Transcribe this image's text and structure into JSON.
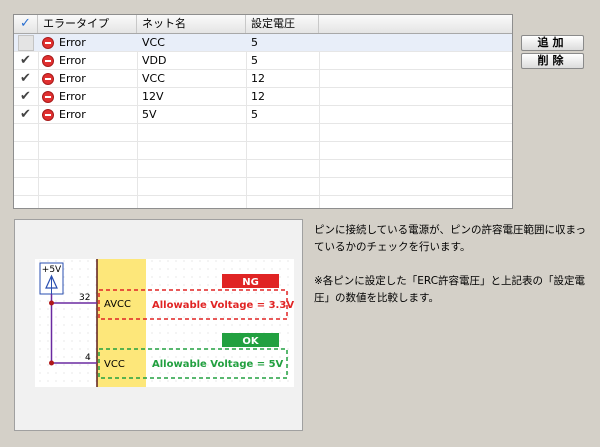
{
  "table": {
    "headers": {
      "check": "✓",
      "error_type": "エラータイプ",
      "net_name": "ネット名",
      "voltage": "設定電圧"
    },
    "rows": [
      {
        "checked": false,
        "error": "Error",
        "net": "VCC",
        "voltage": "5",
        "selected": true
      },
      {
        "checked": true,
        "error": "Error",
        "net": "VDD",
        "voltage": "5",
        "selected": false
      },
      {
        "checked": true,
        "error": "Error",
        "net": "VCC",
        "voltage": "12",
        "selected": false
      },
      {
        "checked": true,
        "error": "Error",
        "net": "12V",
        "voltage": "12",
        "selected": false
      },
      {
        "checked": true,
        "error": "Error",
        "net": "5V",
        "voltage": "5",
        "selected": false
      }
    ]
  },
  "buttons": {
    "add": "追加",
    "delete": "削除"
  },
  "diagram": {
    "power_label": "+5V",
    "pin1_number": "32",
    "pin1_name": "AVCC",
    "pin1_status": "NG",
    "pin1_text": "Allowable Voltage = 3.3V",
    "pin2_number": "4",
    "pin2_name": "VCC",
    "pin2_status": "OK",
    "pin2_text": "Allowable Voltage = 5V",
    "colors": {
      "ng": "#e02424",
      "ok": "#22a040",
      "chip": "#fde77a"
    }
  },
  "description": {
    "line1": "ピンに接続している電源が、ピンの許容電圧範囲に収まっているかのチェックを行います。",
    "line2": "※各ピンに設定した「ERC許容電圧」と上記表の「設定電圧」の数値を比較します。"
  }
}
